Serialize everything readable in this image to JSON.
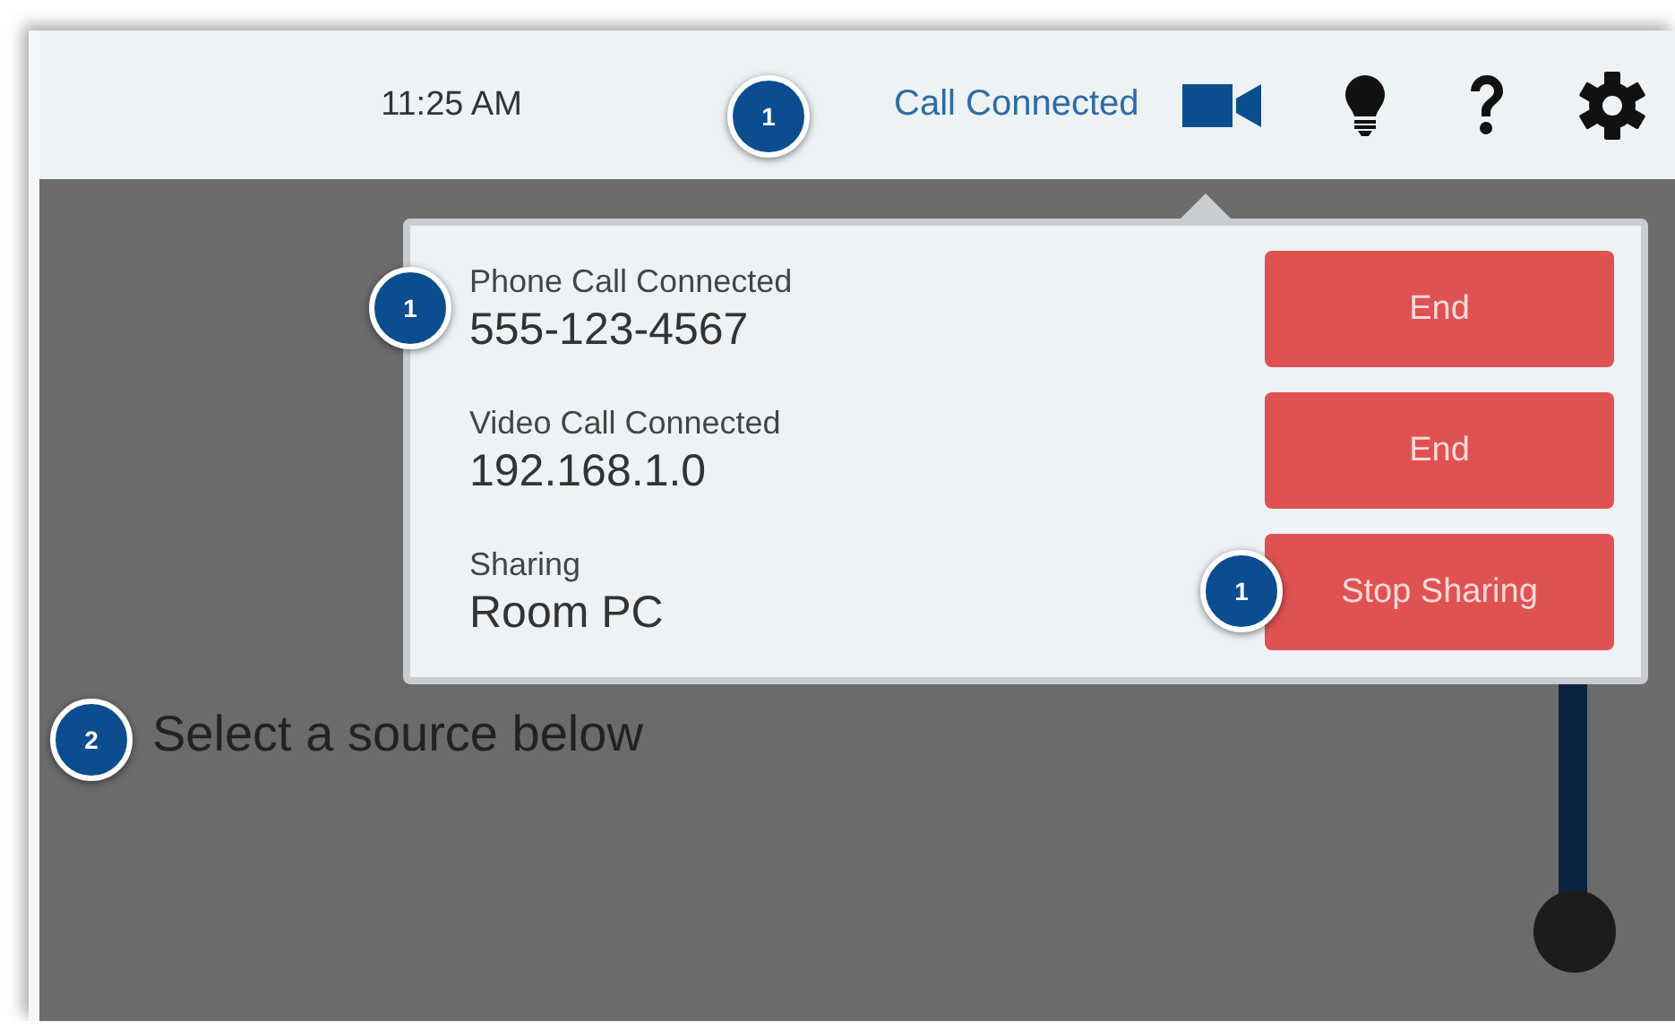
{
  "top_bar": {
    "time": "11:25 AM",
    "callout": "1",
    "status": "Call Connected"
  },
  "popup": {
    "rows": [
      {
        "label": "Phone Call Connected",
        "value": "555-123-4567",
        "button": "End",
        "callout": "1",
        "button_callout": null
      },
      {
        "label": "Video Call Connected",
        "value": "192.168.1.0",
        "button": "End",
        "callout": null,
        "button_callout": null
      },
      {
        "label": "Sharing",
        "value": "Room PC",
        "button": "Stop Sharing",
        "callout": null,
        "button_callout": "1"
      }
    ]
  },
  "source_prompt": {
    "text": "Select a source below",
    "callout": "2"
  }
}
